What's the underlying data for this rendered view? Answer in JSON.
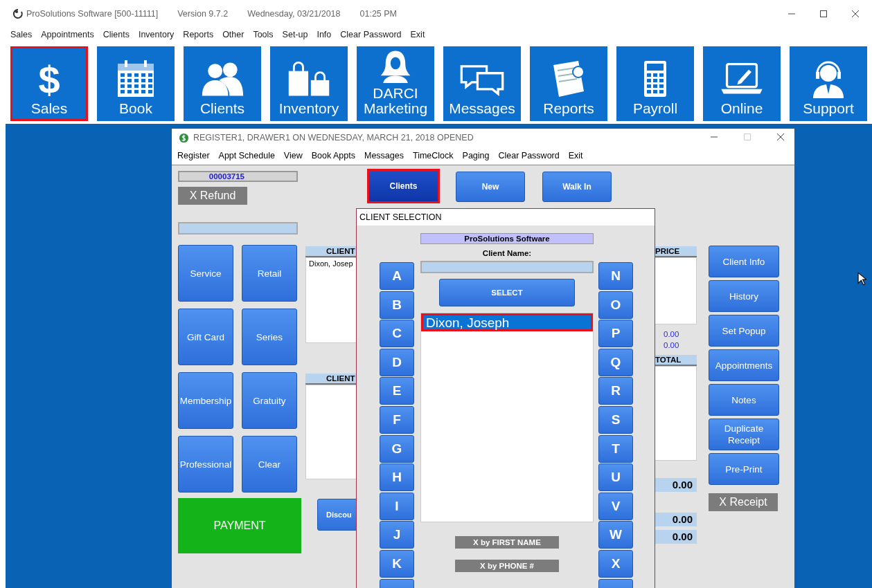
{
  "app_window": {
    "title": "ProSolutions Software [500-11111]",
    "version": "Version 9.7.2",
    "date": "Wednesday, 03/21/2018",
    "time": "01:25 PM",
    "menu": [
      "Sales",
      "Appointments",
      "Clients",
      "Inventory",
      "Reports",
      "Other",
      "Tools",
      "Set-up",
      "Info",
      "Clear Password",
      "Exit"
    ],
    "tiles": [
      {
        "label": "Sales",
        "kind": "dollar",
        "glyph": "$",
        "highlighted": true
      },
      {
        "label": "Book",
        "kind": "calendar",
        "highlighted": false
      },
      {
        "label": "Clients",
        "kind": "people",
        "highlighted": false
      },
      {
        "label": "Inventory",
        "kind": "bags",
        "highlighted": false
      },
      {
        "label": "DARCI\nMarketing",
        "kind": "woman",
        "highlighted": false
      },
      {
        "label": "Messages",
        "kind": "bubbles",
        "highlighted": false
      },
      {
        "label": "Reports",
        "kind": "report",
        "highlighted": false
      },
      {
        "label": "Payroll",
        "kind": "calculator",
        "highlighted": false
      },
      {
        "label": "Online",
        "kind": "laptop",
        "highlighted": false
      },
      {
        "label": "Support",
        "kind": "headset",
        "highlighted": false
      }
    ]
  },
  "register_window": {
    "title": "REGISTER1, DRAWER1 ON WEDNESDAY, MARCH 21, 2018 OPENED",
    "menu": [
      "Register",
      "Appt Schedule",
      "View",
      "Book Appts",
      "Messages",
      "TimeClock",
      "Paging",
      "Clear Password",
      "Exit"
    ],
    "receipt_number": "00003715",
    "refund_button": "X Refund",
    "top_buttons": [
      {
        "label": "Clients",
        "highlighted": true
      },
      {
        "label": "New",
        "highlighted": false
      },
      {
        "label": "Walk In",
        "highlighted": false
      }
    ],
    "sale_buttons": [
      "Service",
      "Retail",
      "Gift Card",
      "Series",
      "Membership",
      "Gratuity",
      "Professional",
      "Clear"
    ],
    "payment_button": "PAYMENT",
    "discount_button": "Discou",
    "items_table": {
      "column_1": "CLIENT",
      "column_last": "PRICE",
      "rows": [
        "Dixon, Josep"
      ]
    },
    "subtotals": [
      "0.00",
      "0.00"
    ],
    "payments_table": {
      "column_1": "CLIENT",
      "column_last": "TOTAL"
    },
    "totals": [
      "0.00",
      "0.00",
      "0.00"
    ],
    "side_buttons": [
      "Client Info",
      "History",
      "Set Popup",
      "Appointments",
      "Notes",
      "Duplicate\nReceipt",
      "Pre-Print"
    ],
    "receipt_button": "X Receipt"
  },
  "client_selection": {
    "title": "CLIENT SELECTION",
    "company": "ProSolutions Software",
    "name_label": "Client Name:",
    "select_button": "SELECT",
    "letters_left": [
      "A",
      "B",
      "C",
      "D",
      "E",
      "F",
      "G",
      "H",
      "I",
      "J",
      "K"
    ],
    "letters_right": [
      "N",
      "O",
      "P",
      "Q",
      "R",
      "S",
      "T",
      "U",
      "V",
      "W",
      "X"
    ],
    "results": [
      {
        "name": "Dixon, Joseph",
        "selected": true,
        "highlighted": true
      }
    ],
    "clear_buttons": [
      "X by FIRST NAME",
      "X by PHONE #"
    ]
  }
}
